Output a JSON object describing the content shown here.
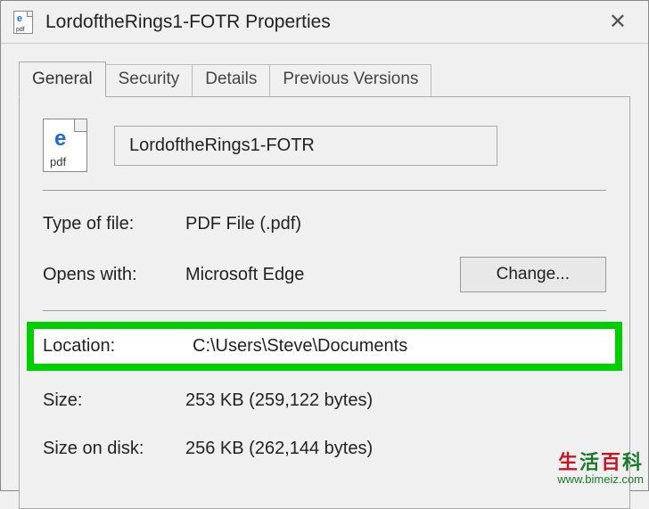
{
  "window": {
    "title": "LordoftheRings1-FOTR Properties"
  },
  "tabs": {
    "general": "General",
    "security": "Security",
    "details": "Details",
    "previous_versions": "Previous Versions"
  },
  "file": {
    "icon_e": "e",
    "icon_pdf": "pdf",
    "name": "LordoftheRings1-FOTR"
  },
  "props": {
    "type_label": "Type of file:",
    "type_value": "PDF File (.pdf)",
    "opens_label": "Opens with:",
    "opens_value": "Microsoft Edge",
    "change_label": "Change...",
    "location_label": "Location:",
    "location_value": "C:\\Users\\Steve\\Documents",
    "size_label": "Size:",
    "size_value": "253 KB (259,122 bytes)",
    "sizedisk_label": "Size on disk:",
    "sizedisk_value": "256 KB (262,144 bytes)"
  },
  "watermark": {
    "cn1": "生",
    "cn2": "活",
    "cn3": "百",
    "cn4": "科",
    "url": "www.bimeiz.com"
  }
}
